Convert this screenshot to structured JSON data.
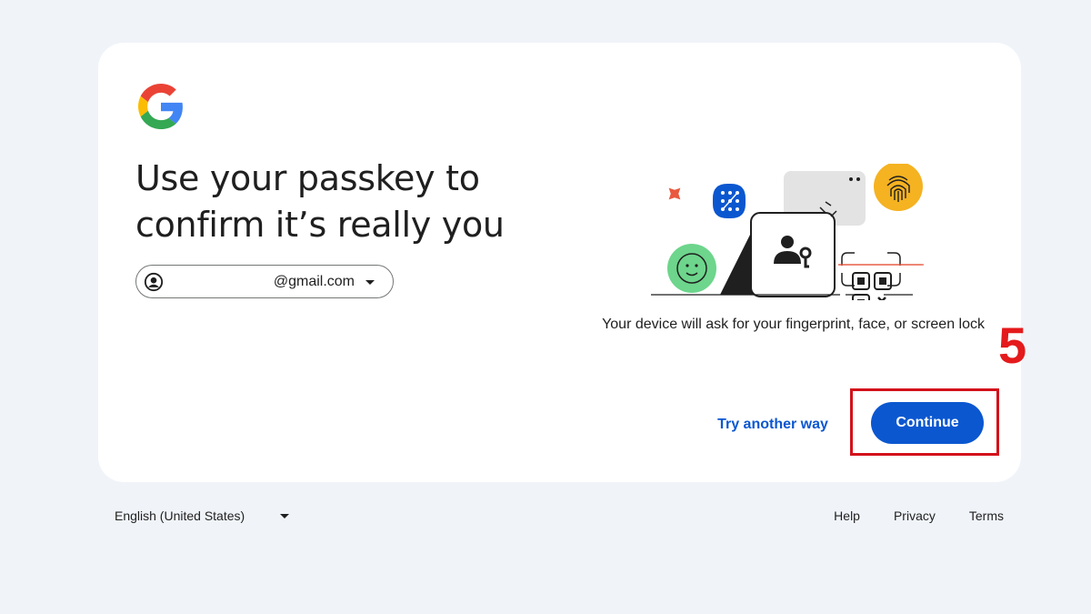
{
  "card": {
    "title": "Use your passkey to confirm it’s really you",
    "account": {
      "email": "@gmail.com",
      "avatar_icon": "account-circle-icon",
      "dropdown_icon": "arrow-drop-down-icon"
    },
    "illustration": {
      "description_icon": "passkey-illustration"
    },
    "device_note": "Your device will ask for your fingerprint, face, or screen lock",
    "try_another_label": "Try another way",
    "continue_label": "Continue"
  },
  "annotation": {
    "step_number": "5",
    "highlight_color": "#d3121b"
  },
  "footer": {
    "language": "English (United States)",
    "links": [
      "Help",
      "Privacy",
      "Terms"
    ]
  },
  "colors": {
    "background": "#f0f4f9",
    "card": "#ffffff",
    "primary": "#0b57d0",
    "text": "#1f1f1f"
  }
}
